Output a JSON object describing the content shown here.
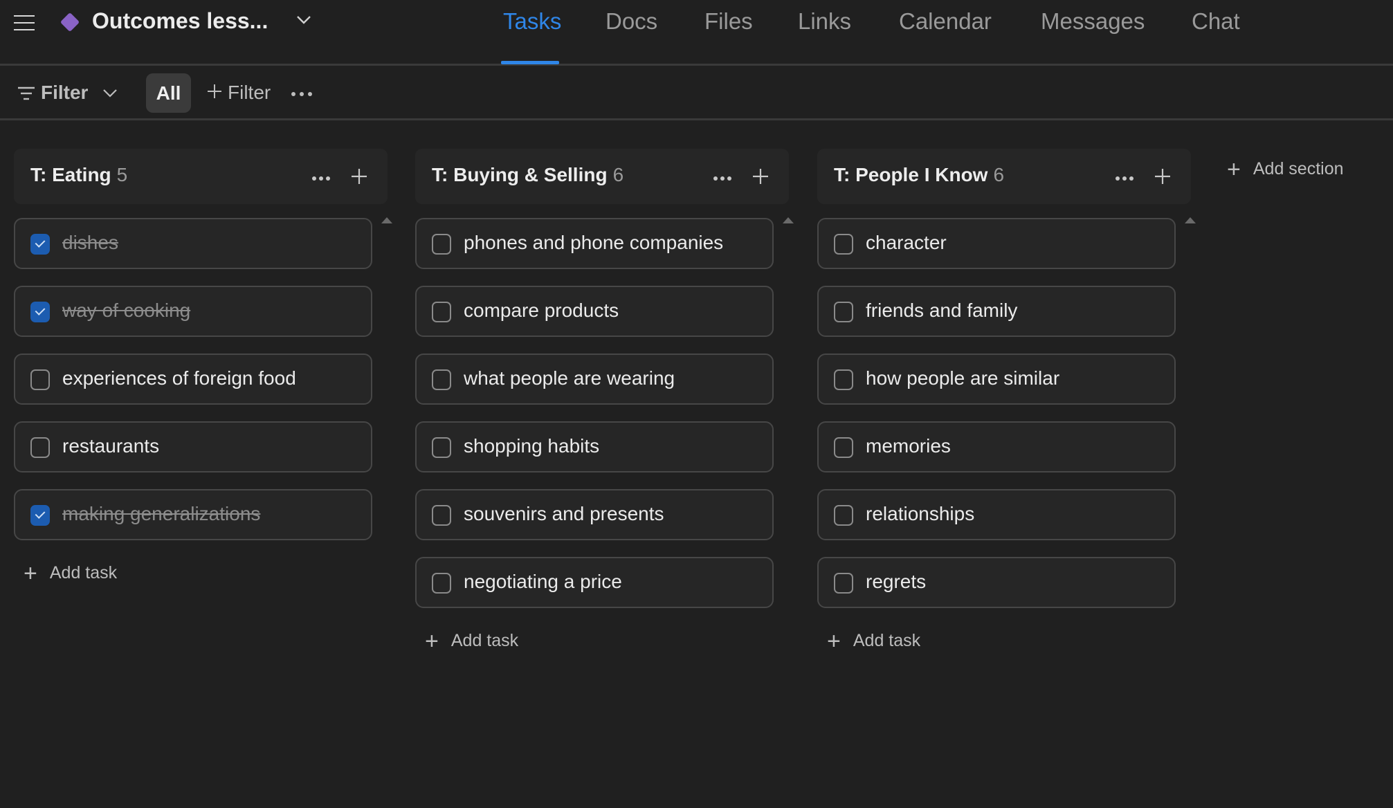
{
  "header": {
    "project_title": "Outcomes less...",
    "project_color": "#8a63c6",
    "tabs": [
      {
        "label": "Tasks",
        "active": true
      },
      {
        "label": "Docs",
        "active": false
      },
      {
        "label": "Files",
        "active": false
      },
      {
        "label": "Links",
        "active": false
      },
      {
        "label": "Calendar",
        "active": false
      },
      {
        "label": "Messages",
        "active": false
      },
      {
        "label": "Chat",
        "active": false
      }
    ]
  },
  "filterbar": {
    "filter_label": "Filter",
    "all_label": "All",
    "add_filter_label": "Filter"
  },
  "columns": [
    {
      "title": "T: Eating",
      "count": "5",
      "add_task_label": "Add task",
      "tasks": [
        {
          "label": "dishes",
          "done": true
        },
        {
          "label": "way of cooking",
          "done": true
        },
        {
          "label": "experiences of foreign food",
          "done": false
        },
        {
          "label": "restaurants",
          "done": false
        },
        {
          "label": "making generalizations",
          "done": true
        }
      ]
    },
    {
      "title": "T: Buying & Selling",
      "count": "6",
      "add_task_label": "Add task",
      "tasks": [
        {
          "label": "phones and phone companies",
          "done": false
        },
        {
          "label": "compare products",
          "done": false
        },
        {
          "label": "what people are wearing",
          "done": false
        },
        {
          "label": "shopping habits",
          "done": false
        },
        {
          "label": "souvenirs and presents",
          "done": false
        },
        {
          "label": "negotiating a price",
          "done": false
        }
      ]
    },
    {
      "title": "T: People I Know",
      "count": "6",
      "add_task_label": "Add task",
      "tasks": [
        {
          "label": "character",
          "done": false
        },
        {
          "label": "friends and family",
          "done": false
        },
        {
          "label": "how people are similar",
          "done": false
        },
        {
          "label": "memories",
          "done": false
        },
        {
          "label": "relationships",
          "done": false
        },
        {
          "label": "regrets",
          "done": false
        }
      ]
    }
  ],
  "add_section_label": "Add section",
  "colors": {
    "accent": "#2f86e8",
    "checkbox_checked": "#1c5cb0",
    "background": "#202020"
  }
}
